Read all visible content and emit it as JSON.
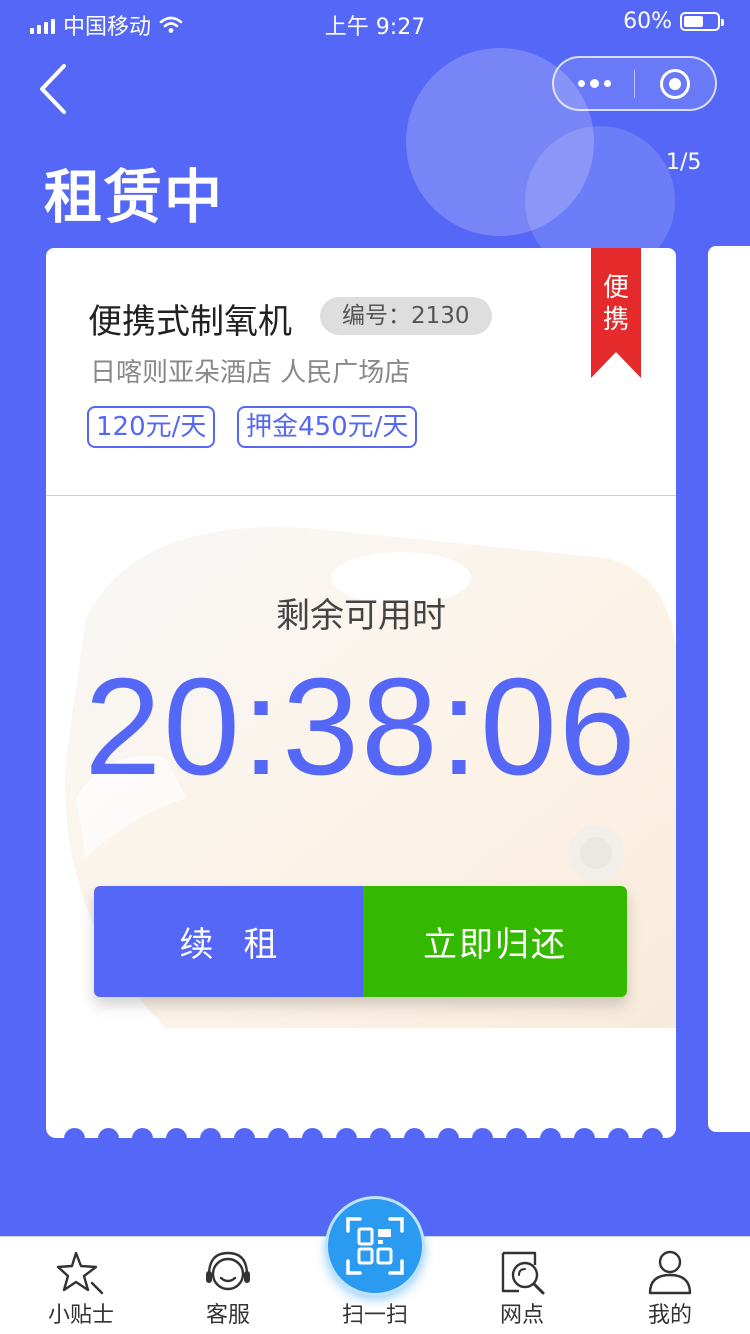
{
  "status_bar": {
    "carrier": "中国移动",
    "time": "上午 9:27",
    "battery": "60%",
    "battery_level": 0.6
  },
  "header": {
    "title": "租赁中",
    "pager": "1/5"
  },
  "rental": {
    "badge": "便携",
    "product_name": "便携式制氧机",
    "serial": "编号：2130",
    "store": "日喀则亚朵酒店 人民广场店",
    "daily_price": "120元/天",
    "deposit": "押金450元/天",
    "remaining_label": "剩余可用时",
    "countdown": "20:38:06",
    "renew_label": "续租",
    "return_label": "立即归还"
  },
  "tabs": [
    {
      "label": "小贴士",
      "icon": "star-icon"
    },
    {
      "label": "客服",
      "icon": "headset-icon"
    },
    {
      "label": "扫一扫",
      "icon": "scan-icon"
    },
    {
      "label": "网点",
      "icon": "map-search-icon"
    },
    {
      "label": "我的",
      "icon": "user-icon"
    }
  ],
  "colors": {
    "primary": "#5567f6",
    "return_green": "#34b900",
    "ribbon_red": "#e52a2c",
    "scan_blue": "#2a9bf0"
  }
}
